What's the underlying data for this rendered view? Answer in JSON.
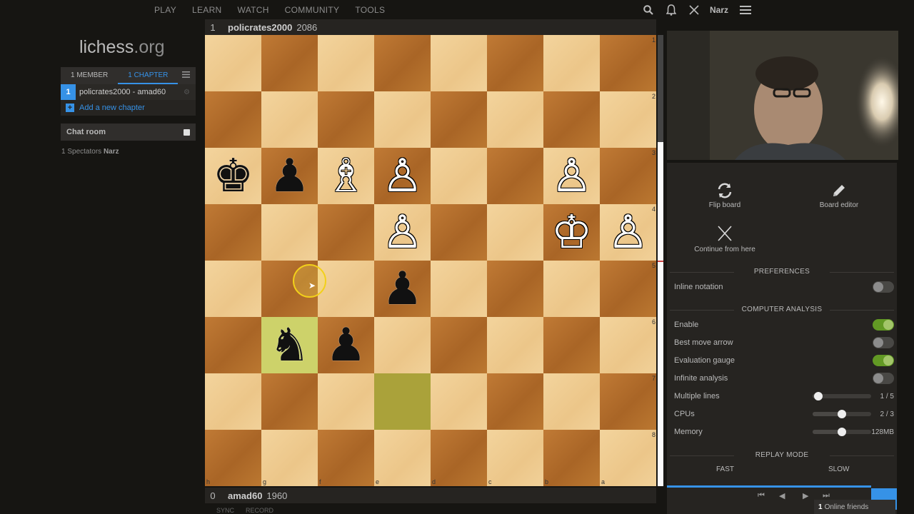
{
  "nav": {
    "items": [
      "PLAY",
      "LEARN",
      "WATCH",
      "COMMUNITY",
      "TOOLS"
    ],
    "username": "Narz",
    "icons": [
      "search-icon",
      "bell-icon",
      "swords-icon",
      "hamburger-icon"
    ]
  },
  "logo": {
    "name": "lichess",
    "tld": ".org"
  },
  "study": {
    "tab_members": "1 MEMBER",
    "tab_chapters": "1 CHAPTER",
    "chapter_number": "1",
    "chapter_title": "policrates2000 - amad60",
    "add_chapter": "Add a new chapter"
  },
  "chat": {
    "title": "Chat room"
  },
  "spectators": {
    "prefix": "1 Spectators",
    "names": "Narz"
  },
  "top_player": {
    "rank": "1",
    "name": "policrates2000",
    "rating": "2086"
  },
  "bottom_player": {
    "rank": "0",
    "name": "amad60",
    "rating": "1960"
  },
  "board": {
    "ranks": [
      "1",
      "2",
      "3",
      "4",
      "5",
      "6",
      "7",
      "8"
    ],
    "files": [
      "h",
      "g",
      "f",
      "e",
      "d",
      "c",
      "b",
      "a"
    ],
    "pieces": [
      {
        "square": "h3",
        "color": "black",
        "type": "king",
        "glyph": "♚"
      },
      {
        "square": "g3",
        "color": "black",
        "type": "pawn",
        "glyph": "♟"
      },
      {
        "square": "f3",
        "color": "white",
        "type": "bishop",
        "glyph": "♗"
      },
      {
        "square": "e3",
        "color": "white",
        "type": "pawn",
        "glyph": "♙"
      },
      {
        "square": "b3",
        "color": "white",
        "type": "pawn",
        "glyph": "♙"
      },
      {
        "square": "e4",
        "color": "white",
        "type": "pawn",
        "glyph": "♙"
      },
      {
        "square": "b4",
        "color": "white",
        "type": "king",
        "glyph": "♔"
      },
      {
        "square": "a4",
        "color": "white",
        "type": "pawn",
        "glyph": "♙"
      },
      {
        "square": "e5",
        "color": "black",
        "type": "pawn",
        "glyph": "♟"
      },
      {
        "square": "g6",
        "color": "black",
        "type": "knight",
        "glyph": "♞"
      },
      {
        "square": "f6",
        "color": "black",
        "type": "pawn",
        "glyph": "♟"
      }
    ],
    "highlight_squares": [
      "g6",
      "e7"
    ]
  },
  "bottom_controls": [
    "SYNC",
    "RECORD"
  ],
  "tools": {
    "flip": "Flip board",
    "editor": "Board editor",
    "continue": "Continue from here"
  },
  "preferences": {
    "title": "PREFERENCES",
    "inline_notation": "Inline notation"
  },
  "analysis": {
    "title": "COMPUTER ANALYSIS",
    "enable": "Enable",
    "best_move_arrow": "Best move arrow",
    "evaluation_gauge": "Evaluation gauge",
    "infinite_analysis": "Infinite analysis",
    "multiple_lines": "Multiple lines",
    "multiple_lines_value": "1 / 5",
    "cpus": "CPUs",
    "cpus_value": "2 / 3",
    "memory": "Memory",
    "memory_value": "128MB"
  },
  "replay": {
    "title": "REPLAY MODE",
    "fast": "FAST",
    "slow": "SLOW"
  },
  "friends": {
    "count": "1",
    "label": "Online friends"
  },
  "toggles": {
    "inline_notation": false,
    "enable": true,
    "best_move_arrow": false,
    "evaluation_gauge": true,
    "infinite_analysis": false
  },
  "sliders": {
    "multiple_lines": 0.1,
    "cpus": 0.5,
    "memory": 0.5
  },
  "colors": {
    "accent": "#3692e7",
    "toggle_on": "#629924",
    "background": "#161512"
  }
}
